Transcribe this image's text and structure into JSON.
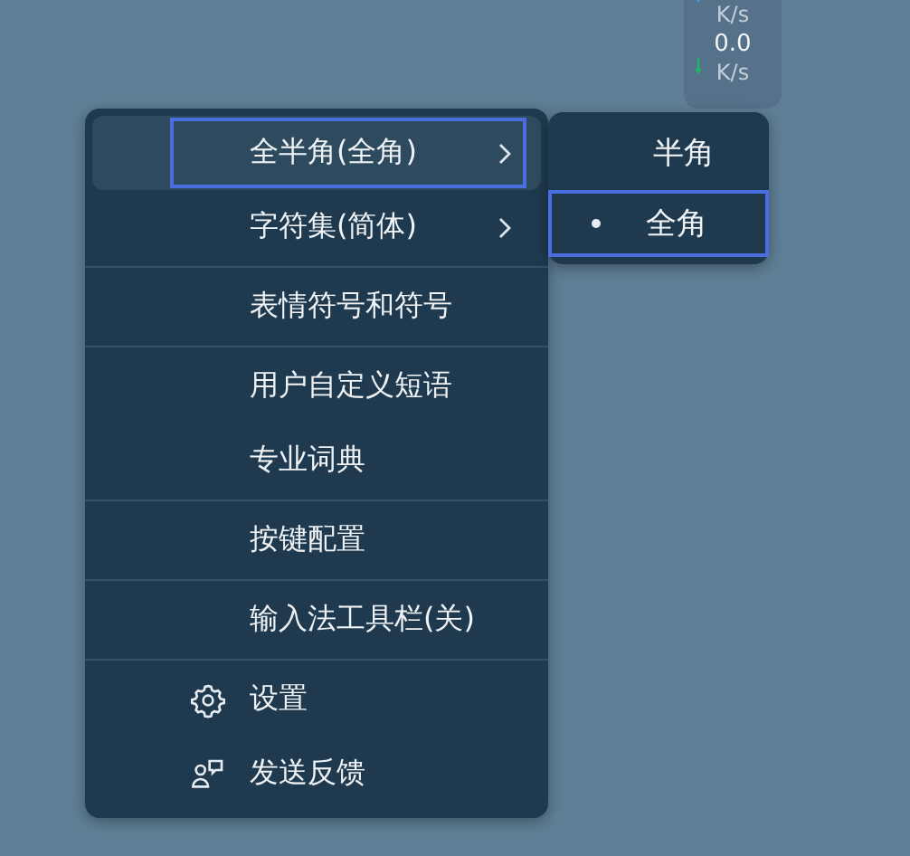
{
  "net_speed": {
    "upload_unit": "K/s",
    "download_value": "0.0",
    "download_unit": "K/s"
  },
  "menu": {
    "items": [
      {
        "label": "全半角(全角)",
        "kind": "submenu",
        "highlighted": true,
        "focused": true,
        "separator_after": false
      },
      {
        "label": "字符集(简体)",
        "kind": "submenu",
        "highlighted": false,
        "focused": false,
        "separator_after": true
      },
      {
        "label": "表情符号和符号",
        "kind": "plain",
        "highlighted": false,
        "focused": false,
        "separator_after": true
      },
      {
        "label": "用户自定义短语",
        "kind": "plain",
        "highlighted": false,
        "focused": false,
        "separator_after": false
      },
      {
        "label": "专业词典",
        "kind": "plain",
        "highlighted": false,
        "focused": false,
        "separator_after": true
      },
      {
        "label": "按键配置",
        "kind": "plain",
        "highlighted": false,
        "focused": false,
        "separator_after": true
      },
      {
        "label": "输入法工具栏(关)",
        "kind": "plain",
        "highlighted": false,
        "focused": false,
        "separator_after": true
      },
      {
        "label": "设置",
        "kind": "settings",
        "highlighted": false,
        "focused": false,
        "separator_after": false
      },
      {
        "label": "发送反馈",
        "kind": "feedback",
        "highlighted": false,
        "focused": false,
        "separator_after": false
      }
    ]
  },
  "submenu": {
    "items": [
      {
        "label": "半角",
        "selected": false,
        "focused": false
      },
      {
        "label": "全角",
        "selected": true,
        "focused": true
      }
    ]
  }
}
